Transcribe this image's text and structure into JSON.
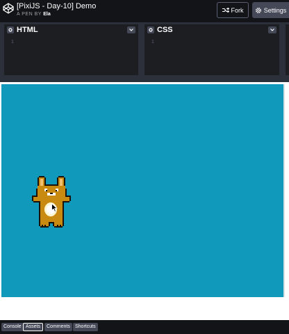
{
  "header": {
    "title": "[PixiJS - Day-10] Demo",
    "by_prefix": "A PEN BY",
    "author": "Ela",
    "fork_label": "Fork",
    "settings_label": "Settings"
  },
  "editors": [
    {
      "label": "HTML",
      "line": "1"
    },
    {
      "label": "CSS",
      "line": "1"
    }
  ],
  "stage": {
    "background": "#1099bb"
  },
  "footer": {
    "tabs": [
      "Console",
      "Assets",
      "Comments",
      "Shortcuts"
    ],
    "active_tab": "Assets"
  }
}
